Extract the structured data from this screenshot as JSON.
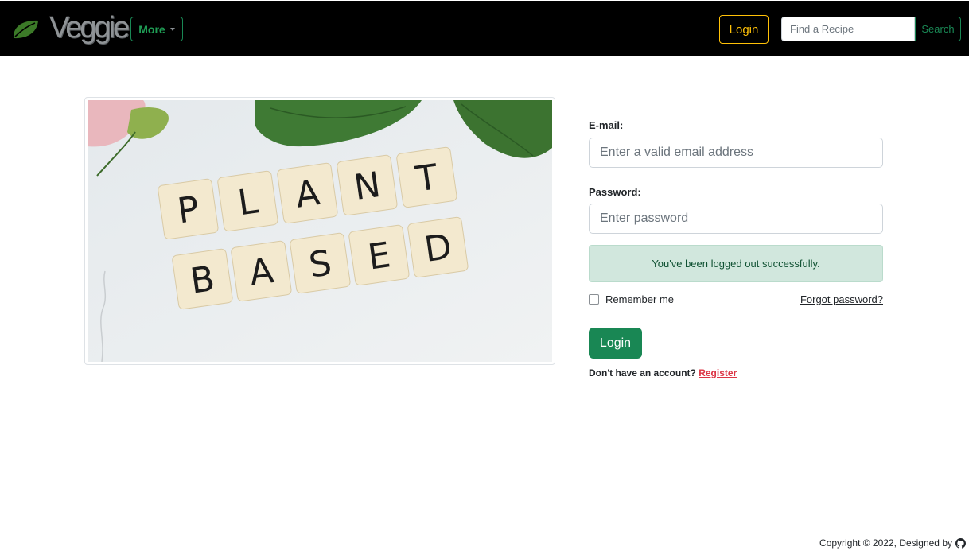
{
  "navbar": {
    "brand": "Veggie",
    "brand_icon": "leaf-icon",
    "more_label": "More",
    "login_label": "Login",
    "search_placeholder": "Find a Recipe",
    "search_label": "Search"
  },
  "hero": {
    "tile_row1": [
      "P",
      "L",
      "A",
      "N",
      "T"
    ],
    "tile_row2": [
      "B",
      "A",
      "S",
      "E",
      "D"
    ]
  },
  "form": {
    "email_label": "E-mail:",
    "email_placeholder": "Enter a valid email address",
    "password_label": "Password:",
    "password_placeholder": "Enter password",
    "alert_text": "You've been logged out successfully.",
    "remember_label": "Remember me",
    "forgot_label": "Forgot password?",
    "login_label": "Login",
    "no_account_text": "Don't have an account?",
    "register_label": "Register"
  },
  "footer": {
    "copyright": "Copyright © 2022, Designed by",
    "icon": "github-icon"
  },
  "colors": {
    "navbar_bg": "#000000",
    "success": "#198754",
    "warning": "#ffc107",
    "danger": "#dc3545",
    "alert_bg": "#d1e7dd"
  }
}
